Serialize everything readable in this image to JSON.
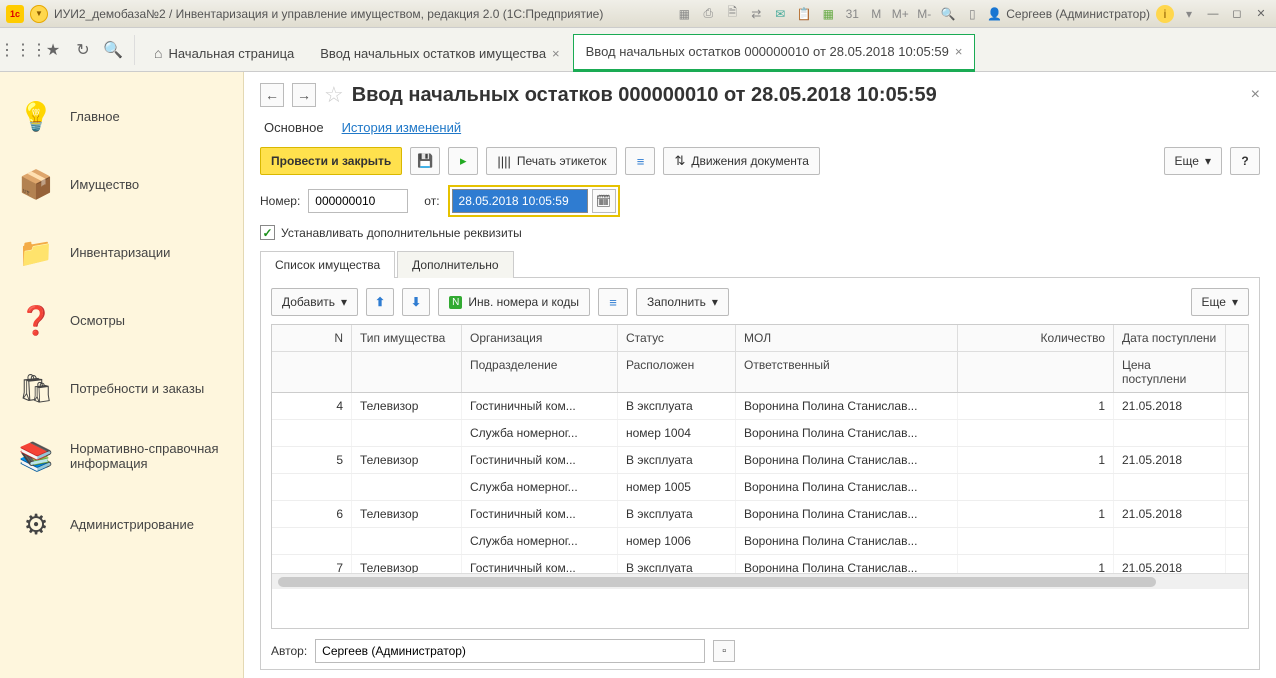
{
  "system": {
    "title": "ИУИ2_демобаза№2 / Инвентаризация и управление имуществом, редакция 2.0  (1С:Предприятие)",
    "user": "Сергеев (Администратор)",
    "m_labels": [
      "M",
      "M+",
      "M-"
    ]
  },
  "tabs": {
    "home": "Начальная страница",
    "t1": "Ввод начальных остатков имущества",
    "t2": "Ввод начальных остатков 000000010 от 28.05.2018 10:05:59"
  },
  "sidebar": {
    "items": [
      {
        "label": "Главное",
        "icon": "💡"
      },
      {
        "label": "Имущество",
        "icon": "📦"
      },
      {
        "label": "Инвентаризации",
        "icon": "📁"
      },
      {
        "label": "Осмотры",
        "icon": "❓"
      },
      {
        "label": "Потребности и заказы",
        "icon": "🛍"
      },
      {
        "label": "Нормативно-справочная информация",
        "icon": "📚"
      },
      {
        "label": "Администрирование",
        "icon": "⚙"
      }
    ]
  },
  "page": {
    "title": "Ввод начальных остатков 000000010 от 28.05.2018 10:05:59",
    "subtabs": {
      "main": "Основное",
      "history": "История изменений"
    },
    "toolbar": {
      "post_close": "Провести и закрыть",
      "print": "Печать этикеток",
      "movements": "Движения документа",
      "more": "Еще"
    },
    "form": {
      "number_label": "Номер:",
      "number_value": "000000010",
      "date_label": "от:",
      "date_value": "28.05.2018 10:05:59",
      "checkbox": "Устанавливать дополнительные реквизиты"
    },
    "midtabs": {
      "list": "Список имущества",
      "extra": "Дополнительно"
    },
    "panel": {
      "add": "Добавить",
      "inv": "Инв. номера и коды",
      "fill": "Заполнить",
      "more": "Еще"
    },
    "table": {
      "head1": {
        "n": "N",
        "type": "Тип имущества",
        "org": "Организация",
        "status": "Статус",
        "mol": "МОЛ",
        "qty": "Количество",
        "date": "Дата поступлени"
      },
      "head2": {
        "org": "Подразделение",
        "status": "Расположен",
        "mol": "Ответственный",
        "date": "Цена поступлени"
      },
      "rows": [
        {
          "n": "4",
          "type": "Телевизор",
          "org": "Гостиничный ком...",
          "status": "В эксплуата",
          "mol": "Воронина Полина Станислав...",
          "qty": "1",
          "date": "21.05.2018",
          "org2": "Служба номерног...",
          "status2": "номер 1004",
          "mol2": "Воронина Полина Станислав..."
        },
        {
          "n": "5",
          "type": "Телевизор",
          "org": "Гостиничный ком...",
          "status": "В эксплуата",
          "mol": "Воронина Полина Станислав...",
          "qty": "1",
          "date": "21.05.2018",
          "org2": "Служба номерног...",
          "status2": "номер 1005",
          "mol2": "Воронина Полина Станислав..."
        },
        {
          "n": "6",
          "type": "Телевизор",
          "org": "Гостиничный ком...",
          "status": "В эксплуата",
          "mol": "Воронина Полина Станислав...",
          "qty": "1",
          "date": "21.05.2018",
          "org2": "Служба номерног...",
          "status2": "номер 1006",
          "mol2": "Воронина Полина Станислав..."
        },
        {
          "n": "7",
          "type": "Телевизор",
          "org": "Гостиничный ком...",
          "status": "В эксплуата",
          "mol": "Воронина Полина Станислав...",
          "qty": "1",
          "date": "21.05.2018",
          "org2": "",
          "status2": "",
          "mol2": ""
        }
      ]
    },
    "author": {
      "label": "Автор:",
      "value": "Сергеев (Администратор)"
    }
  }
}
